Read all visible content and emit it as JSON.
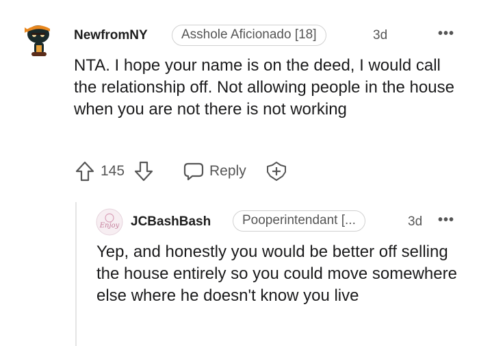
{
  "comment": {
    "avatar_icon": "snoo-pirate-avatar",
    "username": "NewfromNY",
    "flair": "Asshole Aficionado [18]",
    "age": "3d",
    "more_label": "•••",
    "body": "NTA. I hope your name is on the deed, I would call the relationship off. Not allowing people in the house when you are not there is not working",
    "votes": "145",
    "reply_label": "Reply"
  },
  "reply": {
    "avatar_icon": "pink-enjoy-avatar",
    "avatar_text": "Enjoy",
    "username": "JCBashBash",
    "flair": "Pooperintendant [...",
    "age": "3d",
    "more_label": "•••",
    "body": "Yep, and honestly you would be better off selling the house entirely so you could move somewhere else where he doesn't know you live"
  },
  "colors": {
    "text": "#1a1a1b",
    "muted": "#555555",
    "border": "#d0d0d0",
    "thread_line": "#e4e4e4"
  }
}
